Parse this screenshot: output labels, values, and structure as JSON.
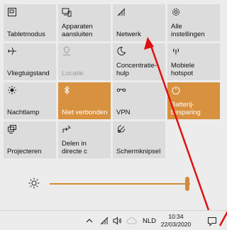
{
  "tiles": [
    {
      "label": "Tabletmodus",
      "icon": "tablet-mode-icon",
      "state": "off"
    },
    {
      "label": "Apparaten\naansluiten",
      "icon": "connect-devices-icon",
      "state": "off"
    },
    {
      "label": "Netwerk",
      "icon": "network-icon",
      "state": "off"
    },
    {
      "label": "Alle\ninstellingen",
      "icon": "settings-icon",
      "state": "off"
    },
    {
      "label": "Vliegtuigstand",
      "icon": "airplane-icon",
      "state": "off"
    },
    {
      "label": "Locatie",
      "icon": "location-icon",
      "state": "disabled"
    },
    {
      "label": "Concentratie-\nhulp",
      "icon": "focus-assist-icon",
      "state": "off"
    },
    {
      "label": "Mobiele\nhotspot",
      "icon": "hotspot-icon",
      "state": "off"
    },
    {
      "label": "Nachtlamp",
      "icon": "night-light-icon",
      "state": "off"
    },
    {
      "label": "Niet verbonden",
      "icon": "bluetooth-icon",
      "state": "on"
    },
    {
      "label": "VPN",
      "icon": "vpn-icon",
      "state": "off"
    },
    {
      "label": "Batterij-\nbesparing",
      "icon": "battery-saver-icon",
      "state": "on"
    },
    {
      "label": "Projecteren",
      "icon": "project-icon",
      "state": "off"
    },
    {
      "label": "Delen in\ndirecte c",
      "icon": "nearby-share-icon",
      "state": "off"
    },
    {
      "label": "Schermknipsel",
      "icon": "snip-icon",
      "state": "off"
    }
  ],
  "brightness": {
    "level_fraction": 0.98,
    "icon": "brightness-sun-icon"
  },
  "taskbar": {
    "language": "NLD",
    "time": "10:34",
    "date": "22/03/2020",
    "icons": [
      "chevron-up-icon",
      "network-icon",
      "speaker-icon",
      "cloud-icon",
      "action-center-icon"
    ]
  },
  "colors": {
    "accent": "#d8913f",
    "annotation": "#e01010"
  }
}
